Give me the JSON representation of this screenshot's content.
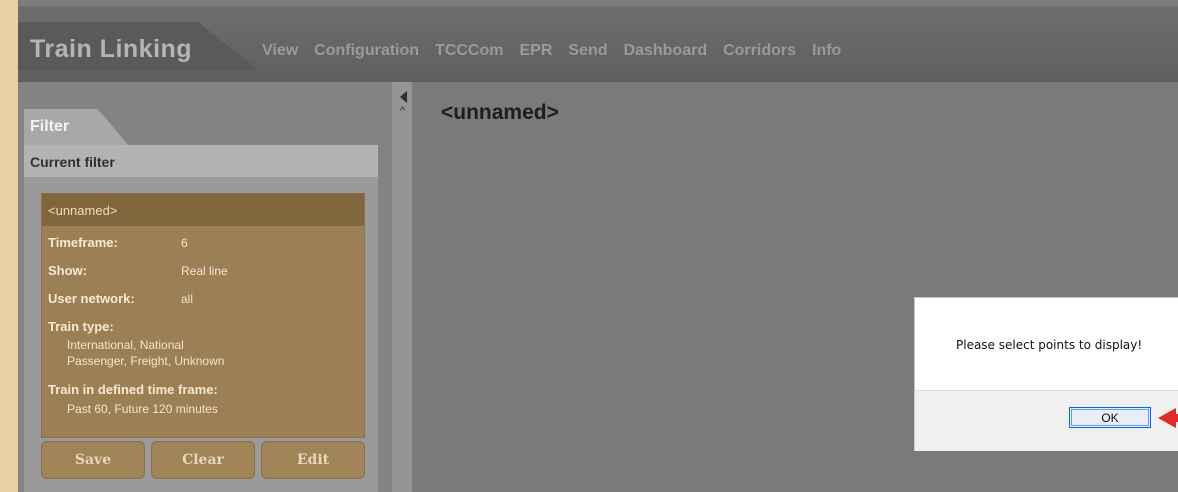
{
  "app": {
    "title": "Train Linking",
    "menu": [
      "View",
      "Configuration",
      "TCCCom",
      "EPR",
      "Send",
      "Dashboard",
      "Corridors",
      "Info"
    ]
  },
  "filter_panel": {
    "tab_label": "Filter",
    "header": "Current filter",
    "card": {
      "name": "<unnamed>",
      "timeframe_label": "Timeframe:",
      "timeframe_value": "6",
      "show_label": "Show:",
      "show_value": "Real line",
      "user_network_label": "User network:",
      "user_network_value": "all",
      "train_type_label": "Train type:",
      "train_type_line1": "International, National",
      "train_type_line2": "Passenger, Freight, Unknown",
      "time_frame_label": "Train in defined time frame:",
      "time_frame_value": "Past 60, Future 120 minutes"
    },
    "buttons": {
      "save": "Save",
      "clear": "Clear",
      "edit": "Edit"
    }
  },
  "splitter": {
    "caret": "^"
  },
  "main": {
    "title": "<unnamed>"
  },
  "dialog": {
    "message": "Please select points to display!",
    "ok_label": "OK"
  }
}
